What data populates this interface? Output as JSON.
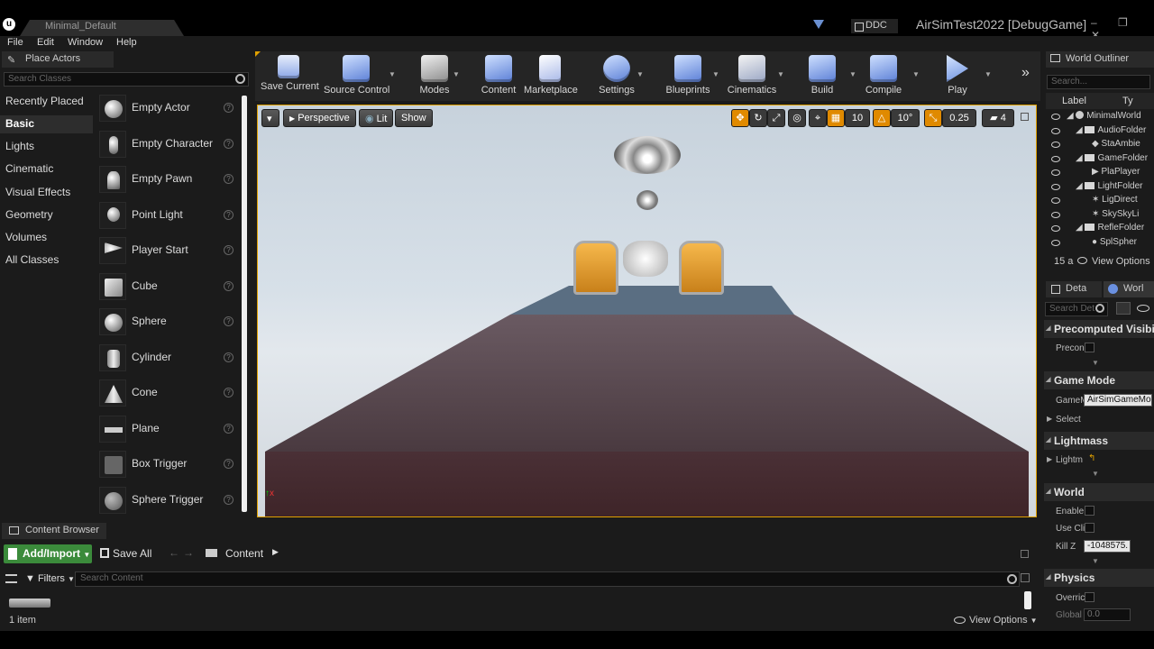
{
  "window": {
    "doc_tab": "Minimal_Default",
    "ddc_label": "DDC",
    "title": "AirSimTest2022 [DebugGame]"
  },
  "menu": [
    "File",
    "Edit",
    "Window",
    "Help"
  ],
  "place_actors": {
    "tab_label": "Place Actors",
    "search_placeholder": "Search Classes",
    "categories": [
      "Recently Placed",
      "Basic",
      "Lights",
      "Cinematic",
      "Visual Effects",
      "Geometry",
      "Volumes",
      "All Classes"
    ],
    "selected_category": "Basic",
    "actors": [
      "Empty Actor",
      "Empty Character",
      "Empty Pawn",
      "Point Light",
      "Player Start",
      "Cube",
      "Sphere",
      "Cylinder",
      "Cone",
      "Plane",
      "Box Trigger",
      "Sphere Trigger"
    ]
  },
  "toolbar": {
    "buttons": [
      "Save Current",
      "Source Control",
      "Modes",
      "Content",
      "Marketplace",
      "Settings",
      "Blueprints",
      "Cinematics",
      "Build",
      "Compile",
      "Play"
    ]
  },
  "viewport": {
    "perspective_label": "Perspective",
    "lit_label": "Lit",
    "show_label": "Show",
    "grid_snap": "10",
    "rotation_snap": "10°",
    "scale_snap": "0.25",
    "camera_speed": "4"
  },
  "outliner": {
    "tab_label": "World Outliner",
    "search_placeholder": "Search...",
    "col_label": "Label",
    "col_type": "Ty",
    "rows": [
      "MinimalWorld",
      "AudioFolder",
      "StaAmbie",
      "GameFolder",
      "PlaPlayer",
      "LightFolder",
      "LigDirect",
      "SkySkyLi",
      "RefleFolder",
      "SplSpher"
    ],
    "count": "15 a",
    "view_options": "View Options"
  },
  "details": {
    "tab_details": "Deta",
    "tab_world": "Worl",
    "search_placeholder": "Search Det",
    "sections": {
      "precomputed": "Precomputed Visibil",
      "game_mode": "Game Mode",
      "lightmass": "Lightmass",
      "world": "World",
      "physics": "Physics"
    },
    "props": {
      "precon": "Precon",
      "gamem": "GameM",
      "gamemode_value": "AirSimGameMode",
      "select": "Select",
      "lightm": "Lightm",
      "enable": "Enable",
      "use_cli": "Use Cli",
      "kill_z": "Kill Z",
      "kill_z_value": "-1048575.",
      "overric": "Overric",
      "global": "Global",
      "global_value": "0.0"
    }
  },
  "content_browser": {
    "tab_label": "Content Browser",
    "add_import": "Add/Import",
    "save_all": "Save All",
    "path": "Content",
    "filters": "Filters",
    "search_placeholder": "Search Content",
    "item_count": "1 item",
    "view_options": "View Options"
  }
}
